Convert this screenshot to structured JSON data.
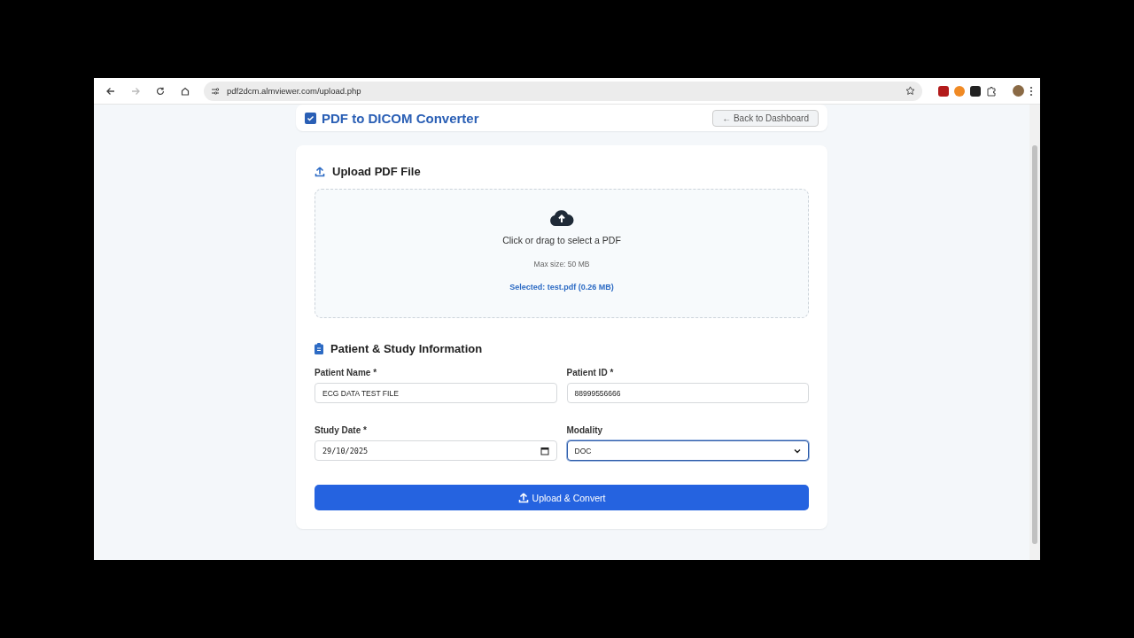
{
  "browser": {
    "url": "pdf2dcm.almviewer.com/upload.php"
  },
  "header": {
    "title": "PDF to DICOM Converter",
    "back_button": "← Back to Dashboard"
  },
  "upload": {
    "title": "Upload PDF File",
    "prompt": "Click or drag to select a PDF",
    "hint": "Max size: 50 MB",
    "selected": "Selected: test.pdf (0.26 MB)"
  },
  "patient": {
    "title": "Patient & Study Information",
    "fields": [
      {
        "kind": "text",
        "label": "Patient Name *",
        "value": "ECG DATA TEST FILE",
        "focused": false
      },
      {
        "kind": "text",
        "label": "Patient ID *",
        "value": "88999556666",
        "focused": false
      },
      {
        "kind": "date",
        "label": "Study Date *",
        "value": "29/10/2025",
        "focused": false
      },
      {
        "kind": "select",
        "label": "Modality",
        "value": "DOC",
        "focused": true
      }
    ]
  },
  "submit": {
    "label": "Upload & Convert"
  }
}
